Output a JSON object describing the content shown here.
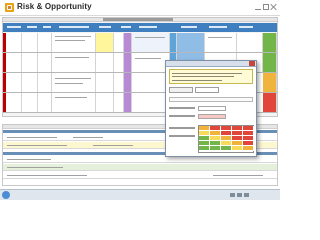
{
  "app": {
    "title": "Risk & Opportunity",
    "logo_icon": "logo-icon"
  },
  "window_controls": {
    "icons": [
      "minimize-icon",
      "maximize-icon",
      "close-icon"
    ]
  },
  "colors": {
    "header_band": "#3f7fbf",
    "risk_id": "#c00000",
    "dialog_note": "#fffbd6",
    "status_red": "#e0463a",
    "status_amber": "#f0b43c",
    "status_green": "#72b548",
    "highlight_yellow": "#fff59a",
    "highlight_purple": "#b88ad6"
  },
  "taskbar": {
    "start_icon": "start-orb-icon",
    "tray_icons": [
      "network-icon",
      "volume-icon",
      "flag-icon"
    ]
  }
}
